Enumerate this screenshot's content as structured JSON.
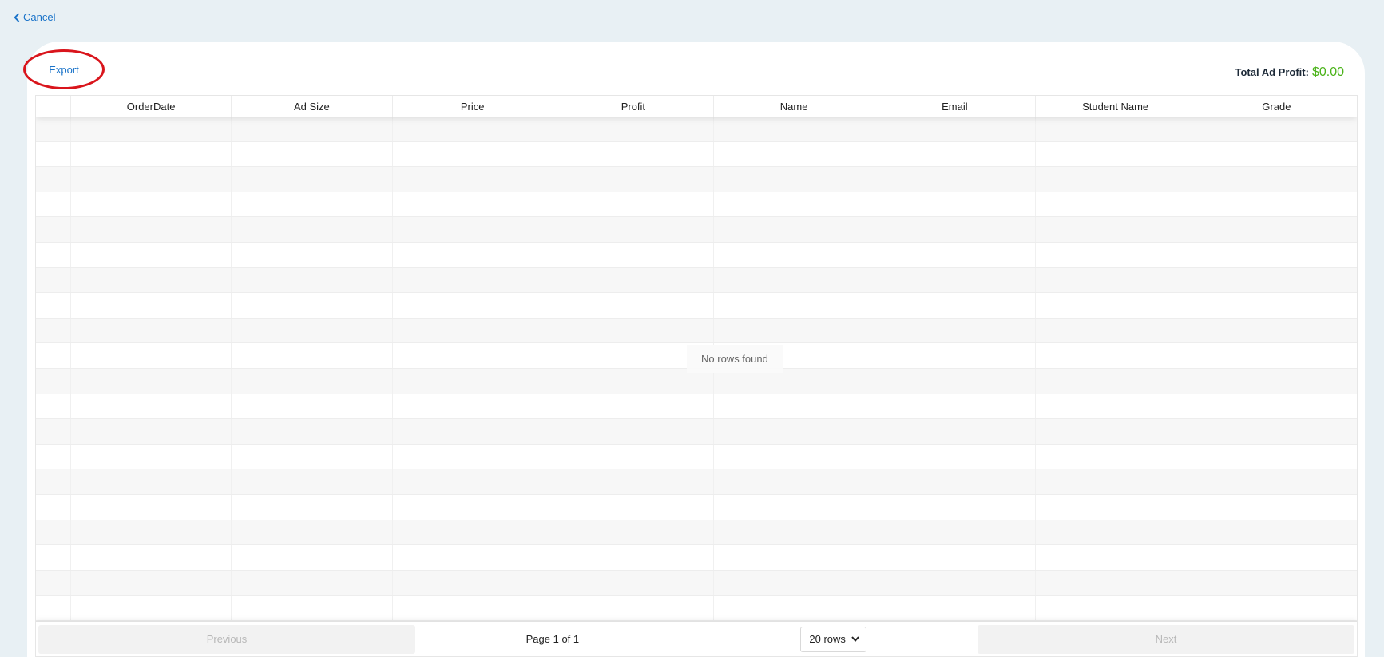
{
  "nav": {
    "cancel_label": "Cancel"
  },
  "toolbar": {
    "export_label": "Export"
  },
  "summary": {
    "label": "Total Ad Profit",
    "separator": ":",
    "amount": "$0.00"
  },
  "table": {
    "columns": [
      "OrderDate",
      "Ad Size",
      "Price",
      "Profit",
      "Name",
      "Email",
      "Student Name",
      "Grade"
    ],
    "rows": [],
    "empty_message": "No rows found"
  },
  "pagination": {
    "previous_label": "Previous",
    "page_info": "Page 1 of 1",
    "rows_selected": "20 rows",
    "next_label": "Next"
  },
  "colors": {
    "link": "#1a73c9",
    "highlight_ring": "#d9151c",
    "profit": "#4bb31a"
  }
}
